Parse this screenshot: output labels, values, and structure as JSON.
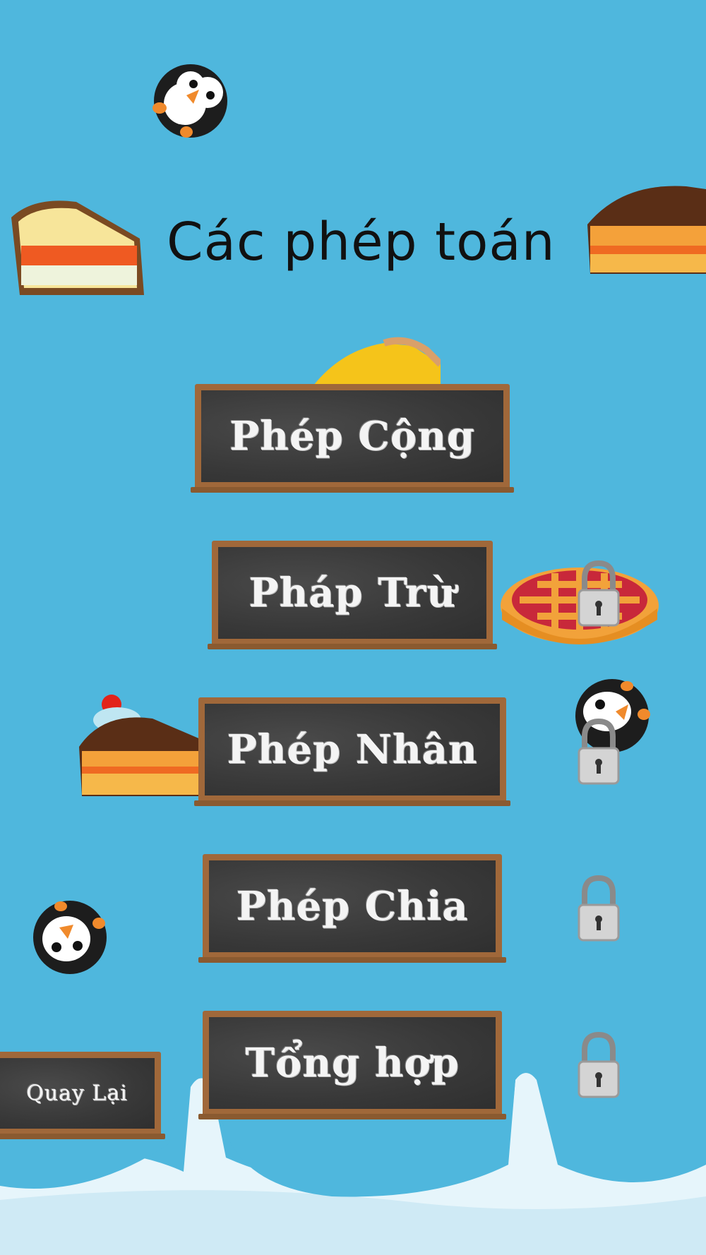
{
  "title": "Các phép toán",
  "menu": [
    {
      "label": "Phép Cộng",
      "locked": false
    },
    {
      "label": "Pháp Trừ",
      "locked": true
    },
    {
      "label": "Phép Nhân",
      "locked": true
    },
    {
      "label": "Phép Chia",
      "locked": true
    },
    {
      "label": "Tổng hợp",
      "locked": true
    }
  ],
  "back_label": "Quay Lại",
  "colors": {
    "background": "#4fb7dd",
    "board_frame": "#a0683a",
    "board_slate": "#3b3b3b"
  }
}
